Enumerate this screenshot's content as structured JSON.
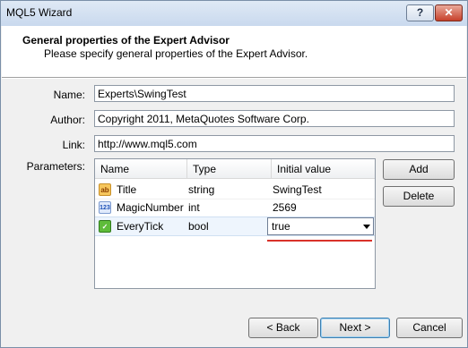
{
  "window": {
    "title": "MQL5 Wizard",
    "help_glyph": "?",
    "close_glyph": "✕"
  },
  "header": {
    "title": "General properties of the Expert Advisor",
    "subtitle": "Please specify general properties of the Expert Advisor."
  },
  "form": {
    "name_label": "Name:",
    "name_value": "Experts\\SwingTest",
    "author_label": "Author:",
    "author_value": "Copyright 2011, MetaQuotes Software Corp.",
    "link_label": "Link:",
    "link_value": "http://www.mql5.com",
    "parameters_label": "Parameters:"
  },
  "parameters": {
    "columns": [
      "Name",
      "Type",
      "Initial value"
    ],
    "rows": [
      {
        "name": "Title",
        "type": "string",
        "value": "SwingTest",
        "icon": "string-icon",
        "icon_text": "ab"
      },
      {
        "name": "MagicNumber",
        "type": "int",
        "value": "2569",
        "icon": "int-icon",
        "icon_text": "123"
      },
      {
        "name": "EveryTick",
        "type": "bool",
        "value": "true",
        "icon": "bool-icon",
        "icon_text": "✓"
      }
    ]
  },
  "side_buttons": {
    "add": "Add",
    "delete": "Delete"
  },
  "footer": {
    "back": "< Back",
    "next": "Next >",
    "cancel": "Cancel"
  },
  "colors": {
    "accent_underline": "#d9322a",
    "selected_row": "#eef5fd"
  }
}
